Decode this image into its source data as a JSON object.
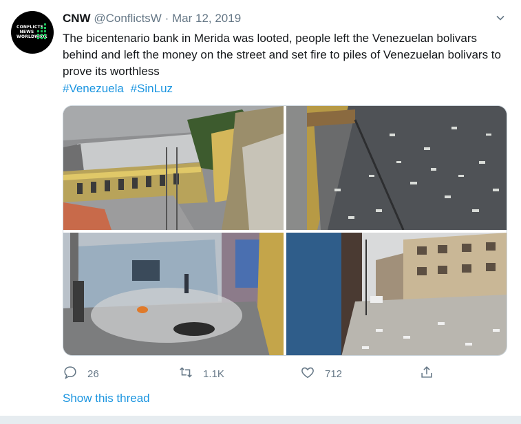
{
  "tweet": {
    "author_name": "CNW",
    "author_handle": "@ConflictsW",
    "separator": "·",
    "date": "Mar 12, 2019",
    "avatar_text": "CONFLICTS NEWS WORLDWIDE",
    "text": "The bicentenario bank in Merida was looted, people left the Venezuelan bolivars behind and left the money on the street and set fire to piles of Venezuelan bolivars to prove its worthless",
    "hashtags": [
      "#Venezuela",
      "#SinLuz"
    ]
  },
  "actions": {
    "reply_count": "26",
    "retweet_count": "1.1K",
    "like_count": "712"
  },
  "show_thread_label": "Show this thread",
  "colors": {
    "link": "#1b95e0",
    "secondary_text": "#657786",
    "avatar_accent": "#1ec45c"
  },
  "icons": {
    "reply": "reply-icon",
    "retweet": "retweet-icon",
    "like": "heart-icon",
    "share": "share-icon",
    "caret": "chevron-down-icon"
  }
}
